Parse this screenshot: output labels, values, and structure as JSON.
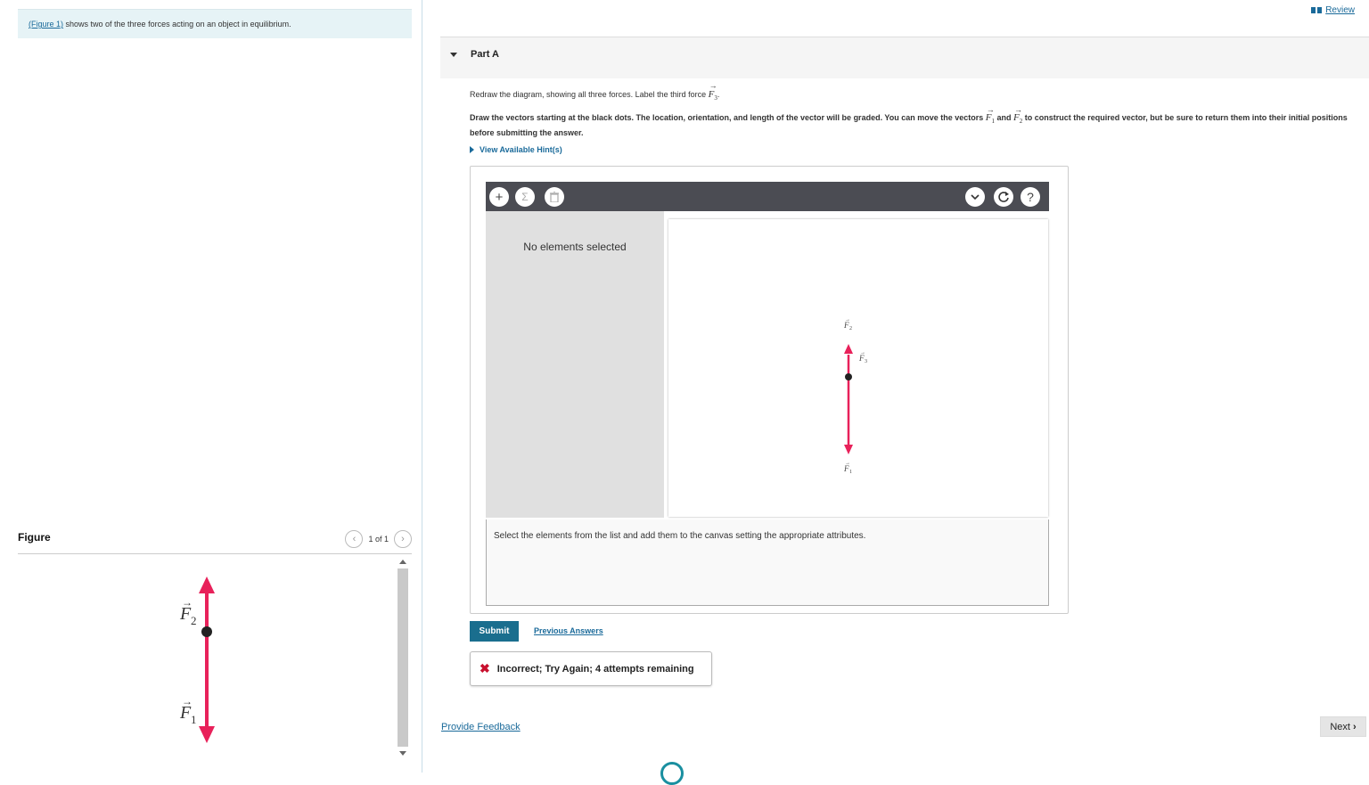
{
  "left": {
    "intro_link": "(Figure 1)",
    "intro_text": " shows two of the three forces acting on an object in equilibrium.",
    "figure_title": "Figure",
    "pager": "1 of 1",
    "figure_labels": {
      "f2": "F",
      "f2_sub": "2",
      "f1": "F",
      "f1_sub": "1"
    }
  },
  "header": {
    "review_label": "Review"
  },
  "part": {
    "title": "Part A"
  },
  "question": {
    "p1_text": "Redraw the diagram, showing all three forces. Label the third force ",
    "p1_sym": "F",
    "p1_sub": "3",
    "p2_a": "Draw the vectors starting at the black dots. The location, orientation, and length of the vector will be graded. You can move the vectors ",
    "p2_sym1": "F",
    "p2_sub1": "1",
    "p2_and": " and ",
    "p2_sym2": "F",
    "p2_sub2": "2",
    "p2_b": " to construct the required vector, but be sure to return them into their initial positions before submitting the answer.",
    "hints_label": "View Available Hint(s)"
  },
  "tool": {
    "no_selection": "No elements selected",
    "instructions": "Select the elements from the list and add them to the canvas setting the appropriate attributes.",
    "canvas_labels": {
      "f2": "F",
      "f2_sub": "2",
      "f3": "F",
      "f3_sub": "3",
      "f1": "F",
      "f1_sub": "1"
    },
    "icons": [
      "plus-icon",
      "sigma-icon",
      "trash-icon",
      "chevron-down-icon",
      "reset-icon",
      "help-icon"
    ]
  },
  "actions": {
    "submit_label": "Submit",
    "previous_answers": "Previous Answers",
    "feedback_text": "Incorrect; Try Again; 4 attempts remaining",
    "provide_feedback": "Provide Feedback",
    "next_label": "Next"
  },
  "colors": {
    "vector": "#e8215a",
    "accent": "#1a6e8e",
    "toolbar": "#4b4c53"
  }
}
